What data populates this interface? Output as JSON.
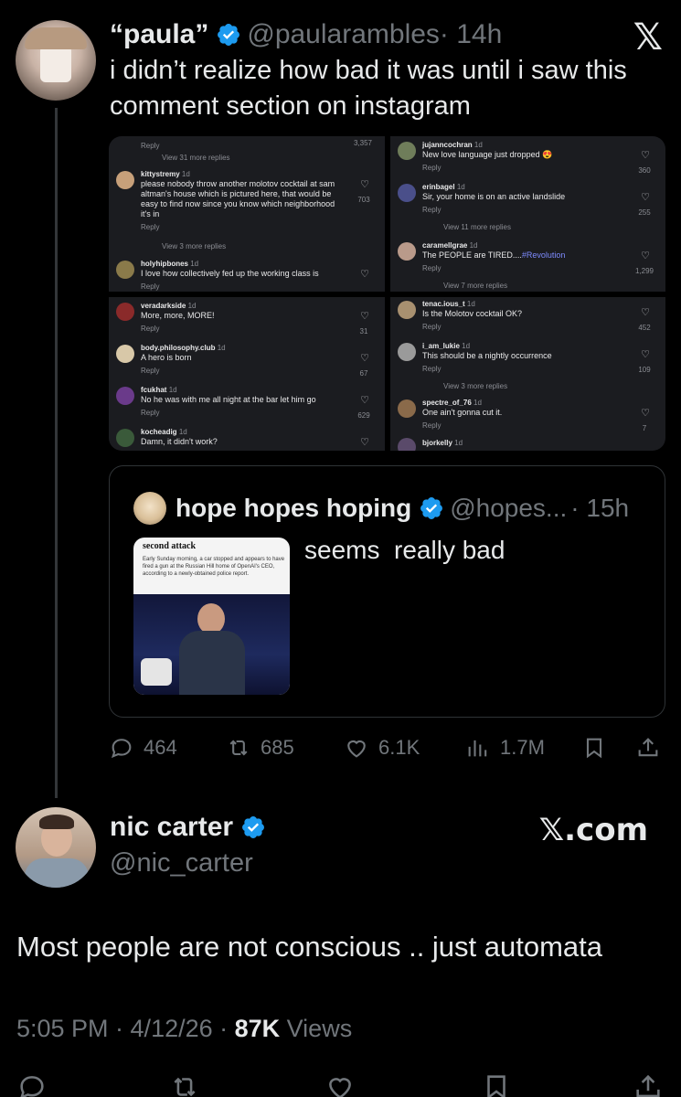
{
  "close_logo": "𝕏",
  "tweet": {
    "display_name": "“paula”",
    "handle": "@paularambles",
    "time": "· 14h",
    "text": "i didn’t realize how bad it was until i saw this comment section on instagram",
    "stats": {
      "replies": "464",
      "retweets": "685",
      "likes": "6.1K",
      "views": "1.7M"
    }
  },
  "instagram": {
    "top_left": {
      "reply_top": "Reply",
      "count_top": "3,357",
      "view_more_1": "View 31 more replies",
      "c1": {
        "user": "kittystremy",
        "age": "1d",
        "text": "please nobody throw another molotov cocktail at sam altman's house which is pictured here, that would be easy to find now since you know which neighborhood it's in",
        "reply": "Reply",
        "count": "703"
      },
      "view_more_2": "View 3 more replies",
      "c2": {
        "user": "holyhipbones",
        "age": "1d",
        "text": "I love how collectively fed up the working class is",
        "reply": "Reply"
      }
    },
    "top_right": {
      "c1": {
        "user": "jujanncochran",
        "age": "1d",
        "text": "New love language just dropped 😍",
        "reply": "Reply",
        "count": "360"
      },
      "c2": {
        "user": "erinbagel",
        "age": "1d",
        "text": "Sir, your home is on an active landslide",
        "reply": "Reply",
        "count": "255"
      },
      "view_more_1": "View 11 more replies",
      "c3": {
        "user": "caramellgrae",
        "age": "1d",
        "text": "The PEOPLE are TIRED....",
        "tag": "#Revolution",
        "reply": "Reply",
        "count": "1,299"
      },
      "view_more_2": "View 7 more replies"
    },
    "bottom_left": {
      "c1": {
        "user": "veradarkside",
        "age": "1d",
        "text": "More, more, MORE!",
        "reply": "Reply",
        "count": "31"
      },
      "c2": {
        "user": "body.philosophy.club",
        "age": "1d",
        "text": "A hero is born",
        "reply": "Reply",
        "count": "67"
      },
      "c3": {
        "user": "fcukhat",
        "age": "1d",
        "text": "No he was with me all night at the bar let him go",
        "reply": "Reply",
        "count": "629"
      },
      "c4": {
        "user": "kocheadig",
        "age": "1d",
        "text": "Damn, it didn't work?"
      }
    },
    "bottom_right": {
      "c1": {
        "user": "tenac.ious_t",
        "age": "1d",
        "text": "Is the Molotov cocktail OK?",
        "reply": "Reply",
        "count": "452"
      },
      "c2": {
        "user": "i_am_lukie",
        "age": "1d",
        "text": "This should be a nightly occurrence",
        "reply": "Reply",
        "count": "109"
      },
      "view_more": "View 3 more replies",
      "c3": {
        "user": "spectre_of_76",
        "age": "1d",
        "text": "One ain't gonna cut it.",
        "reply": "Reply",
        "count": "7"
      },
      "c4": {
        "user": "bjorkelly",
        "age": "1d"
      }
    }
  },
  "quote": {
    "display_name": "hope hopes hoping",
    "handle": "@hopes...",
    "time": "· 15h",
    "text": "seems  really bad",
    "article_headline": "second attack",
    "article_body": "Early Sunday morning, a car stopped and appears to have fired a gun at the Russian Hill home of OpenAI's CEO, according to a newly-obtained police report."
  },
  "reply_tweet": {
    "display_name": "nic carter",
    "handle": "@nic_carter",
    "brand": "𝕏.com",
    "text": "Most people are not conscious .. just automata",
    "time": "5:05 PM · 4/12/26 · ",
    "views_count": "87K",
    "views_label": " Views"
  },
  "colors": {
    "background": "#000000",
    "text": "#e7e9ea",
    "muted": "#71767b",
    "verified": "#1d9bf0",
    "border": "#2f3336"
  }
}
